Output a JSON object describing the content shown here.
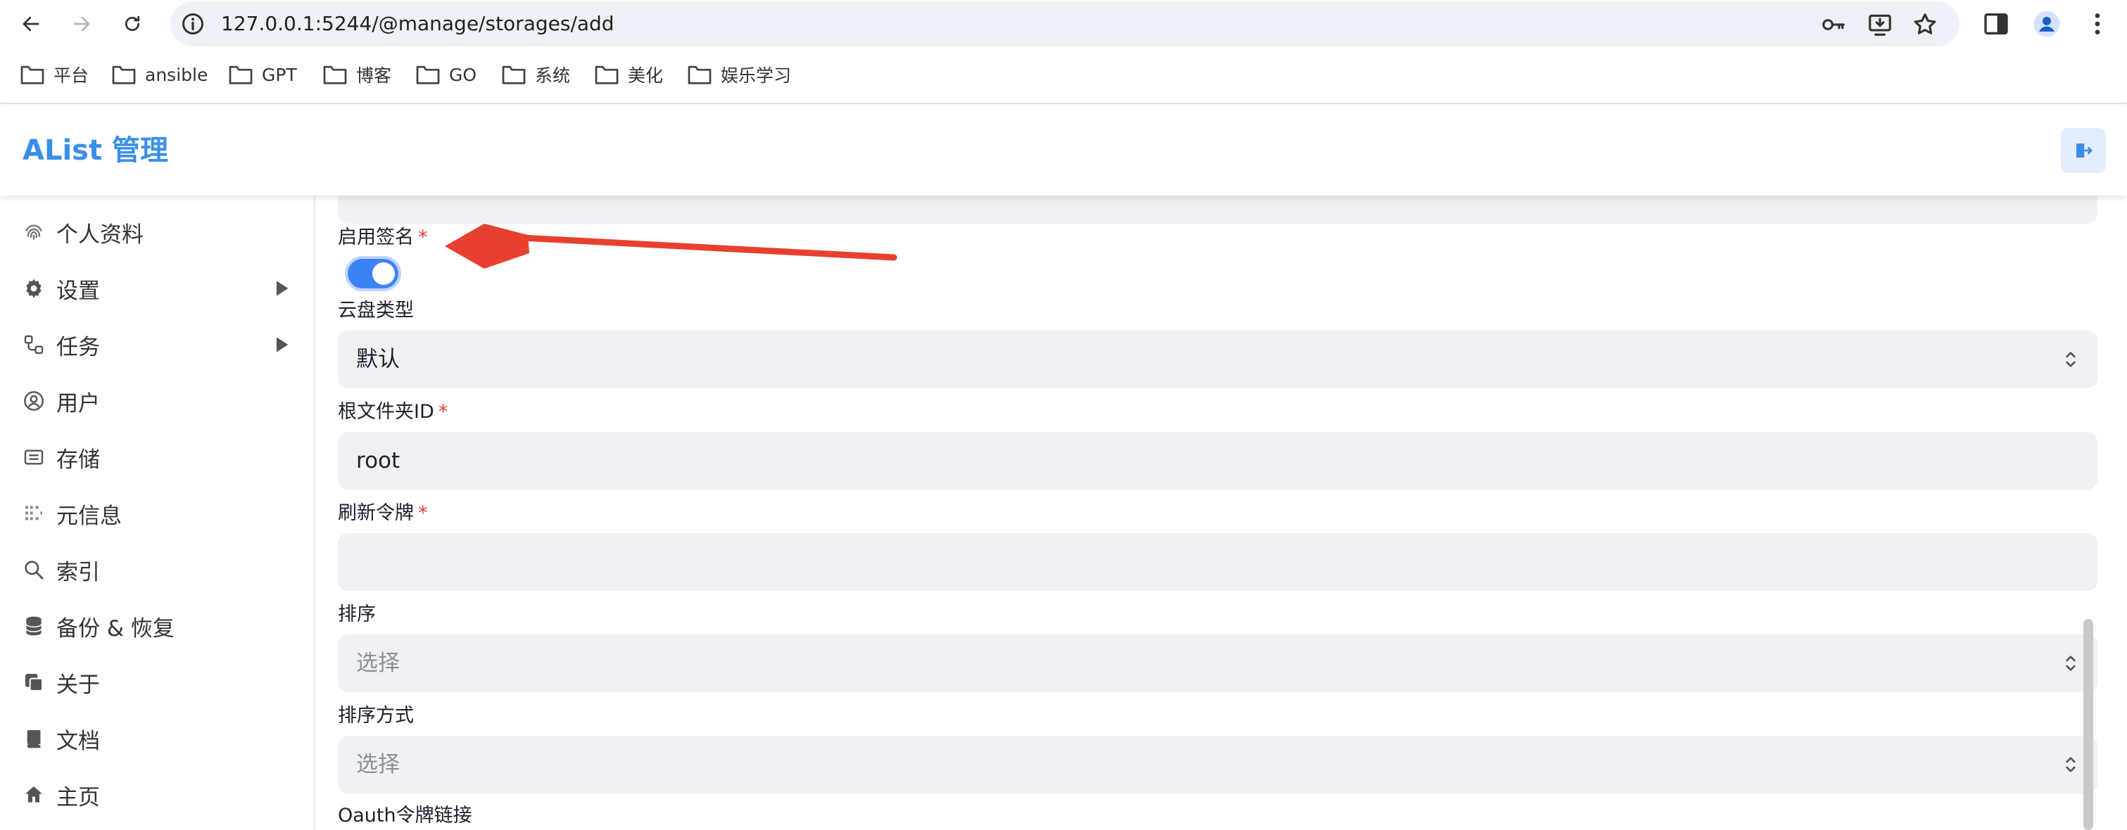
{
  "browser": {
    "url": "127.0.0.1:5244/@manage/storages/add"
  },
  "bookmarks": [
    {
      "label": "平台"
    },
    {
      "label": "ansible"
    },
    {
      "label": "GPT"
    },
    {
      "label": "博客"
    },
    {
      "label": "GO"
    },
    {
      "label": "系统"
    },
    {
      "label": "美化"
    },
    {
      "label": "娱乐学习"
    }
  ],
  "header": {
    "title": "AList 管理"
  },
  "sidebar": {
    "items": [
      {
        "label": "个人资料",
        "icon": "fingerprint-icon"
      },
      {
        "label": "设置",
        "icon": "gear-icon",
        "expandable": true
      },
      {
        "label": "任务",
        "icon": "flow-icon",
        "expandable": true
      },
      {
        "label": "用户",
        "icon": "user-circle-icon"
      },
      {
        "label": "存储",
        "icon": "storage-icon"
      },
      {
        "label": "元信息",
        "icon": "meta-icon"
      },
      {
        "label": "索引",
        "icon": "search-icon"
      },
      {
        "label": "备份 & 恢复",
        "icon": "database-icon"
      },
      {
        "label": "关于",
        "icon": "copy-icon"
      },
      {
        "label": "文档",
        "icon": "book-icon"
      },
      {
        "label": "主页",
        "icon": "home-icon"
      }
    ]
  },
  "form": {
    "sign": {
      "label": "启用签名",
      "required": "*",
      "enabled": true
    },
    "cloud_type": {
      "label": "云盘类型",
      "value": "默认"
    },
    "root_id": {
      "label": "根文件夹ID",
      "required": "*",
      "value": "root"
    },
    "refresh_token": {
      "label": "刷新令牌",
      "required": "*",
      "value": ""
    },
    "order_by": {
      "label": "排序",
      "placeholder": "选择"
    },
    "order_direction": {
      "label": "排序方式",
      "placeholder": "选择"
    },
    "oauth_url": {
      "label": "Oauth令牌链接"
    }
  },
  "colors": {
    "accent": "#3b8ee8",
    "toggle_on": "#3b82f6",
    "required": "#e53e3e",
    "annotation_arrow": "#e8402f",
    "input_bg": "#f0f1f4"
  }
}
